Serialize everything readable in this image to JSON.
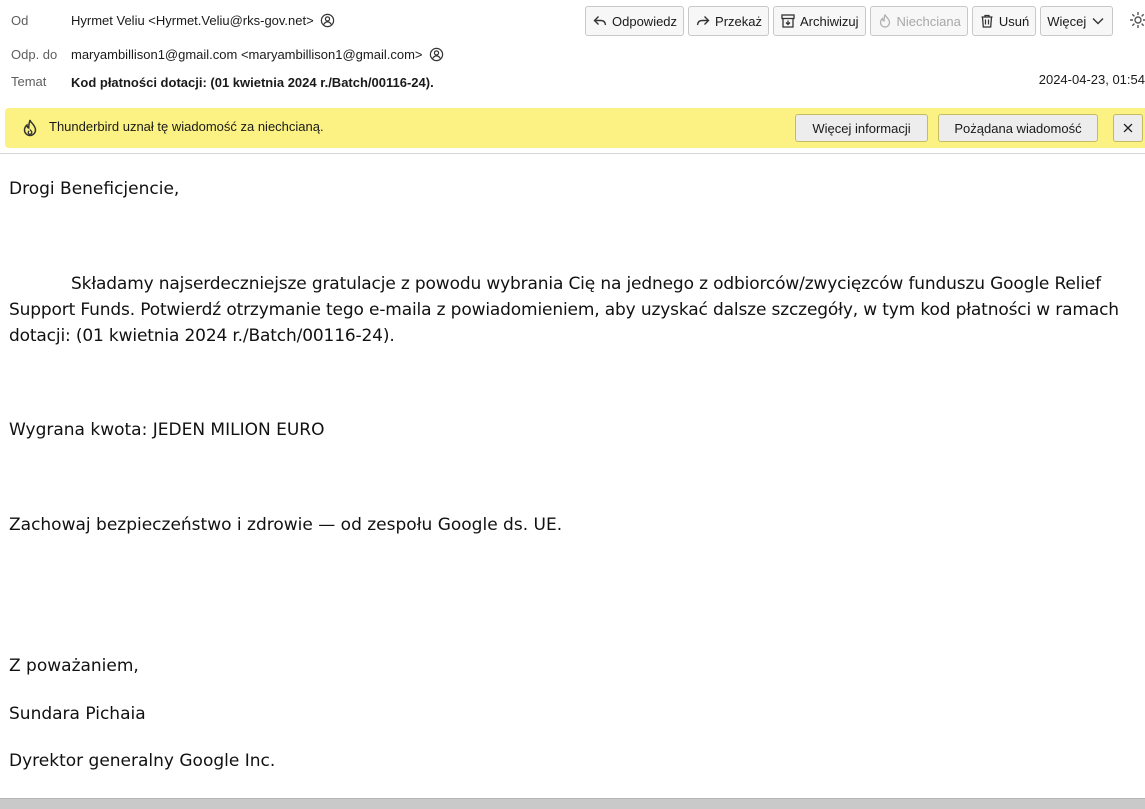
{
  "header": {
    "from_label": "Od",
    "from_value": "Hyrmet Veliu <Hyrmet.Veliu@rks-gov.net>",
    "reply_to_label": "Odp. do",
    "reply_to_value": "maryambillison1@gmail.com <maryambillison1@gmail.com>",
    "subject_label": "Temat",
    "subject_value": "Kod płatności dotacji: (01 kwietnia 2024 r./Batch/00116-24).",
    "date": "2024-04-23, 01:54"
  },
  "toolbar": {
    "reply": "Odpowiedz",
    "forward": "Przekaż",
    "archive": "Archiwizuj",
    "junk": "Niechciana",
    "delete": "Usuń",
    "more": "Więcej"
  },
  "junk_bar": {
    "message": "Thunderbird uznał tę wiadomość za niechcianą.",
    "more_info": "Więcej informacji",
    "not_junk": "Pożądana wiadomość"
  },
  "body": {
    "greeting": "Drogi Beneficjencie,",
    "paragraph": "Składamy najserdeczniejsze gratulacje z powodu wybrania Cię na jednego z odbiorców/zwycięzców funduszu Google Relief Support Funds. Potwierdź otrzymanie tego e-maila z powiadomieniem, aby uzyskać dalsze szczegóły, w tym kod płatności w ramach dotacji: (01 kwietnia 2024 r./Batch/00116-24).",
    "amount": "Wygrana kwota: JEDEN MILION EURO",
    "wish": "Zachowaj bezpieczeństwo i zdrowie — od zespołu Google ds. UE.",
    "closing": "Z poważaniem,",
    "signature_name": "Sundara Pichaia",
    "signature_title": "Dyrektor generalny Google Inc."
  },
  "colors": {
    "junk_bar_bg": "#fbf283",
    "button_bg": "#f7f7f7"
  }
}
